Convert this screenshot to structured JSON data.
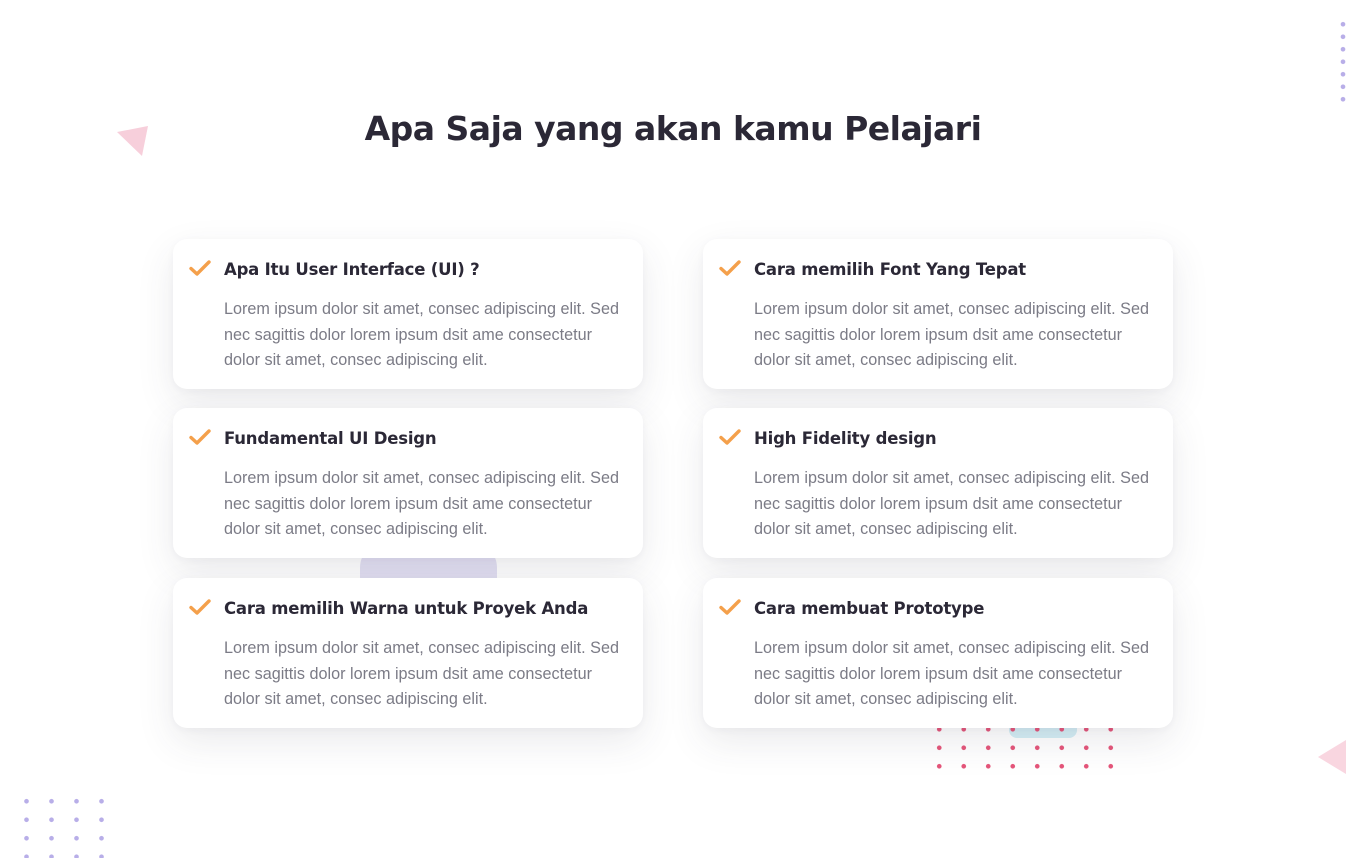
{
  "section": {
    "title": "Apa Saja yang akan kamu Pelajari"
  },
  "colors": {
    "accent": "#f4a04b",
    "heading": "#2b2836",
    "body_text": "#7b7b86",
    "decor_pink": "#f7cfdb",
    "decor_purple_dots": "#b8aee8",
    "decor_red_dots": "#e5557a"
  },
  "topics": [
    {
      "title": "Apa Itu User Interface (UI) ?",
      "description": "Lorem ipsum dolor sit amet, consec adipiscing elit. Sed nec sagittis dolor lorem ipsum dsit ame consectetur dolor sit amet, consec adipiscing elit.",
      "icon": "check-icon"
    },
    {
      "title": "Cara memilih Font Yang Tepat",
      "description": "Lorem ipsum dolor sit amet, consec adipiscing elit. Sed nec sagittis dolor lorem ipsum dsit ame consectetur dolor sit amet, consec adipiscing elit.",
      "icon": "check-icon"
    },
    {
      "title": "Fundamental UI Design",
      "description": "Lorem ipsum dolor sit amet, consec adipiscing elit. Sed nec sagittis dolor lorem ipsum dsit ame consectetur dolor sit amet, consec adipiscing elit.",
      "icon": "check-icon"
    },
    {
      "title": "High Fidelity design",
      "description": "Lorem ipsum dolor sit amet, consec adipiscing elit. Sed nec sagittis dolor lorem ipsum dsit ame consectetur dolor sit amet, consec adipiscing elit.",
      "icon": "check-icon"
    },
    {
      "title": "Cara memilih Warna untuk Proyek Anda",
      "description": "Lorem ipsum dolor sit amet, consec adipiscing elit. Sed nec sagittis dolor lorem ipsum dsit ame consectetur dolor sit amet, consec adipiscing elit.",
      "icon": "check-icon"
    },
    {
      "title": "Cara membuat Prototype",
      "description": "Lorem ipsum dolor sit amet, consec adipiscing elit. Sed nec sagittis dolor lorem ipsum dsit ame consectetur dolor sit amet, consec adipiscing elit.",
      "icon": "check-icon"
    }
  ]
}
